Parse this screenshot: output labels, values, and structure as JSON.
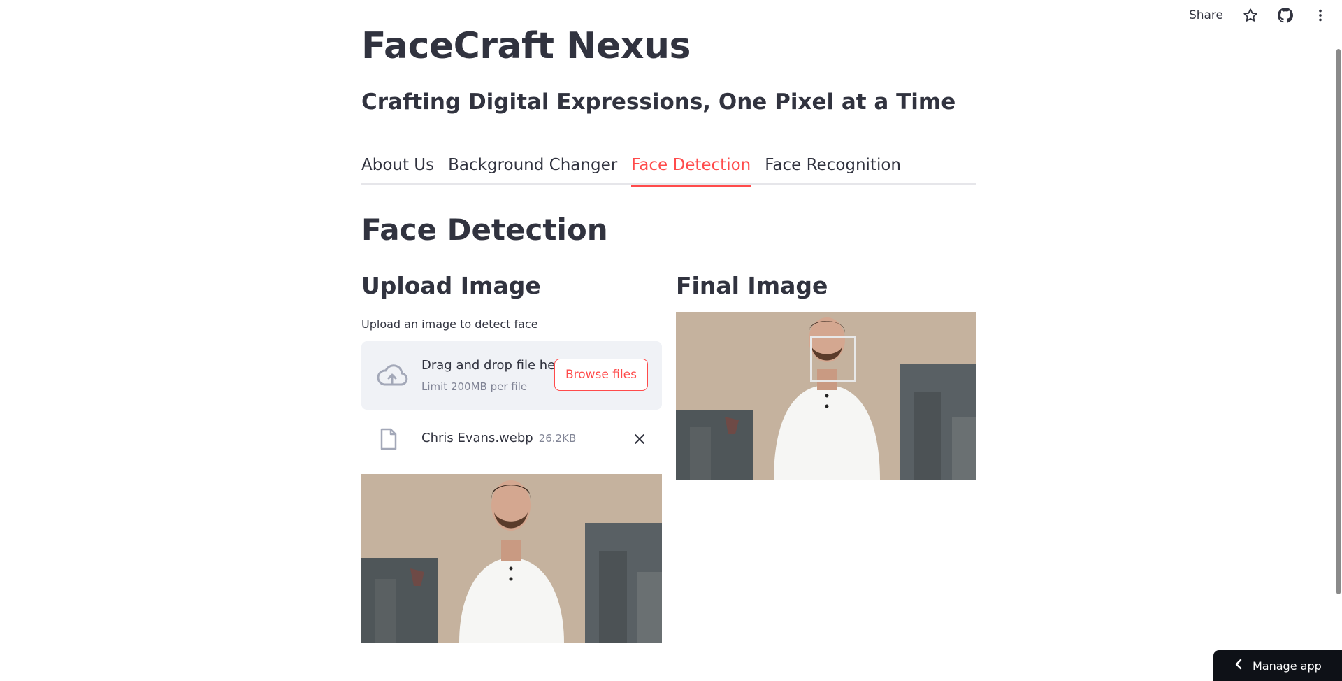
{
  "header": {
    "share_label": "Share",
    "icons": [
      "star-icon",
      "github-icon",
      "more-vert-icon"
    ]
  },
  "app": {
    "title": "FaceCraft Nexus",
    "subtitle": "Crafting Digital Expressions, One Pixel at a Time"
  },
  "tabs": [
    {
      "label": "About Us",
      "active": false
    },
    {
      "label": "Background Changer",
      "active": false
    },
    {
      "label": "Face Detection",
      "active": true
    },
    {
      "label": "Face Recognition",
      "active": false
    }
  ],
  "main": {
    "section_title": "Face Detection",
    "upload": {
      "heading": "Upload Image",
      "label": "Upload an image to detect face",
      "drop_text": "Drag and drop file here",
      "limit_text": "Limit 200MB per file",
      "browse_label": "Browse files",
      "file": {
        "name": "Chris Evans.webp",
        "size": "26.2KB"
      }
    },
    "result": {
      "heading": "Final Image"
    }
  },
  "footer": {
    "manage_label": "Manage app"
  },
  "colors": {
    "accent": "#ff4b4b",
    "text": "#31333f",
    "muted": "#808495",
    "dropzone_bg": "#f0f2f6",
    "manage_bg": "#0e1117"
  }
}
